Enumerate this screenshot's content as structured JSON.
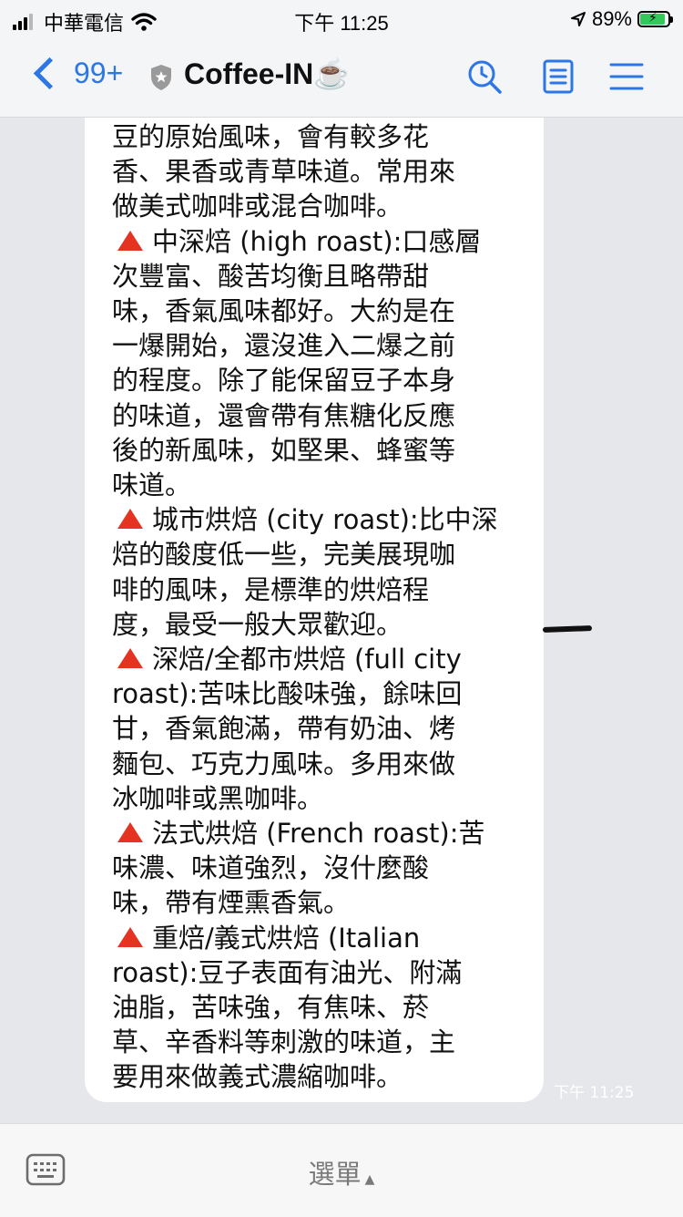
{
  "status_bar": {
    "carrier": "中華電信",
    "time": "下午 11:25",
    "battery": "89%",
    "battery_level": 0.89
  },
  "nav": {
    "back_count": "99+",
    "title": "Coffee-IN☕"
  },
  "message": {
    "lines": [
      {
        "marker": false,
        "text": "豆的原始風味，會有較多花"
      },
      {
        "marker": false,
        "text": "香、果香或青草味道。常用來"
      },
      {
        "marker": false,
        "text": "做美式咖啡或混合咖啡。"
      },
      {
        "marker": true,
        "text": "中深焙 (high roast):口感層"
      },
      {
        "marker": false,
        "text": "次豐富、酸苦均衡且略帶甜"
      },
      {
        "marker": false,
        "text": "味，香氣風味都好。大約是在"
      },
      {
        "marker": false,
        "text": "一爆開始，還沒進入二爆之前"
      },
      {
        "marker": false,
        "text": "的程度。除了能保留豆子本身"
      },
      {
        "marker": false,
        "text": "的味道，還會帶有焦糖化反應"
      },
      {
        "marker": false,
        "text": "後的新風味，如堅果、蜂蜜等"
      },
      {
        "marker": false,
        "text": "味道。"
      },
      {
        "marker": true,
        "text": "城市烘焙 (city roast):比中深"
      },
      {
        "marker": false,
        "text": "焙的酸度低一些，完美展現咖"
      },
      {
        "marker": false,
        "text": "啡的風味，是標準的烘焙程"
      },
      {
        "marker": false,
        "text": "度，最受一般大眾歡迎。"
      },
      {
        "marker": true,
        "text": "深焙/全都市烘焙 (full city"
      },
      {
        "marker": false,
        "text": "roast):苦味比酸味強，餘味回"
      },
      {
        "marker": false,
        "text": "甘，香氣飽滿，帶有奶油、烤"
      },
      {
        "marker": false,
        "text": "麵包、巧克力風味。多用來做"
      },
      {
        "marker": false,
        "text": "冰咖啡或黑咖啡。"
      },
      {
        "marker": true,
        "text": "法式烘焙 (French roast):苦"
      },
      {
        "marker": false,
        "text": "味濃、味道強烈，沒什麼酸"
      },
      {
        "marker": false,
        "text": "味，帶有煙熏香氣。"
      },
      {
        "marker": true,
        "text": "重焙/義式烘焙 (Italian"
      },
      {
        "marker": false,
        "text": "roast):豆子表面有油光、附滿"
      },
      {
        "marker": false,
        "text": "油脂，苦味強，有焦味、菸"
      },
      {
        "marker": false,
        "text": "草、辛香料等刺激的味道，主"
      },
      {
        "marker": false,
        "text": "要用來做義式濃縮咖啡。"
      }
    ],
    "timestamp": "下午 11:25",
    "marker_color": "#e53322"
  },
  "bottom_bar": {
    "menu_label": "選單",
    "caret": "▲"
  },
  "colors": {
    "accent": "#2d76e6",
    "chat_background": "#e6e7ea",
    "bubble": "#ffffff"
  }
}
